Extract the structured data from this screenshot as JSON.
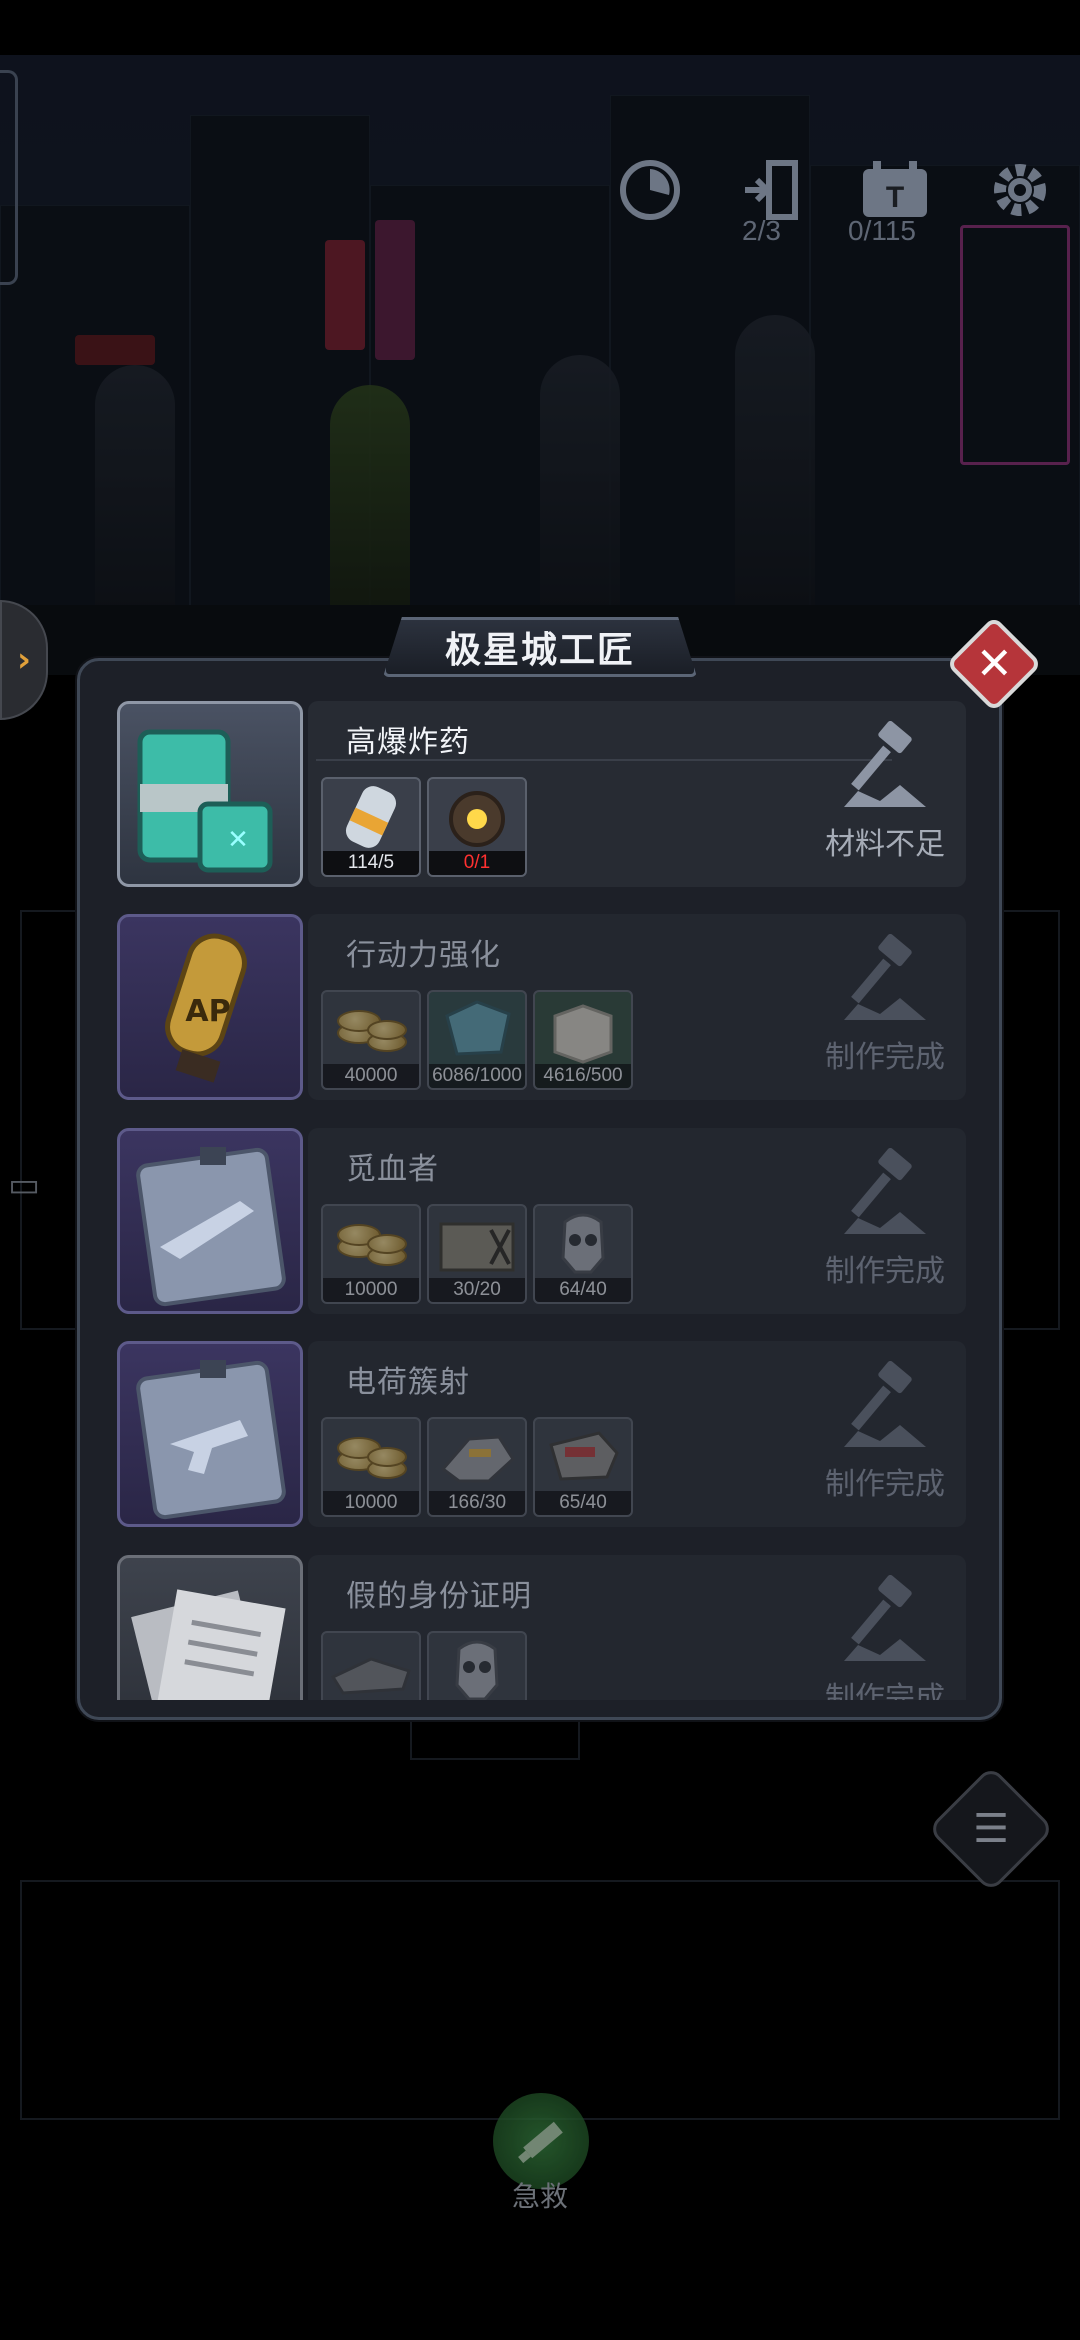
{
  "hud": {
    "timer_icon": "timer-icon",
    "door_count": "2/3",
    "ticket_count": "0/115",
    "settings_icon": "gear-icon"
  },
  "dialog": {
    "title": "极星城工匠",
    "close_icon": "close-icon",
    "recipes": [
      {
        "name": "高爆炸药",
        "status": "材料不足",
        "icon": "explosive-crate-icon",
        "materials": [
          {
            "icon": "capsule-icon",
            "count": "114/5",
            "insufficient": false
          },
          {
            "icon": "orb-core-icon",
            "count": "0/1",
            "insufficient": true
          }
        ]
      },
      {
        "name": "行动力强化",
        "status": "制作完成",
        "icon": "ap-booster-icon",
        "materials": [
          {
            "icon": "coin-stack-icon",
            "count": "40000",
            "insufficient": false
          },
          {
            "icon": "crystal-ore-icon",
            "count": "6086/1000",
            "insufficient": false
          },
          {
            "icon": "cube-block-icon",
            "count": "4616/500",
            "insufficient": false
          }
        ]
      },
      {
        "name": "觅血者",
        "status": "制作完成",
        "icon": "weapon-blueprint-icon",
        "materials": [
          {
            "icon": "coin-stack-icon",
            "count": "10000",
            "insufficient": false
          },
          {
            "icon": "supply-crate-icon",
            "count": "30/20",
            "insufficient": false
          },
          {
            "icon": "skull-mask-icon",
            "count": "64/40",
            "insufficient": false
          }
        ]
      },
      {
        "name": "电荷簇射",
        "status": "制作完成",
        "icon": "pistol-blueprint-icon",
        "materials": [
          {
            "icon": "coin-stack-icon",
            "count": "10000",
            "insufficient": false
          },
          {
            "icon": "mech-part-icon",
            "count": "166/30",
            "insufficient": false
          },
          {
            "icon": "device-part-icon",
            "count": "65/40",
            "insufficient": false
          }
        ]
      },
      {
        "name": "假的身份证明",
        "status": "制作完成",
        "icon": "documents-icon",
        "materials": [
          {
            "icon": "scrap-icon",
            "count": "",
            "insufficient": false
          },
          {
            "icon": "skull-mask-icon",
            "count": "",
            "insufficient": false
          }
        ]
      }
    ]
  },
  "bottom": {
    "rescue_label": "急救",
    "list_icon": "checklist-icon",
    "chat_icon": "chat-icon"
  },
  "colors": {
    "dialog_bg": "#1d2028",
    "close_red": "#b6353a",
    "insufficient_red": "#ff3030",
    "blueprint_purple": "#3b3560"
  }
}
